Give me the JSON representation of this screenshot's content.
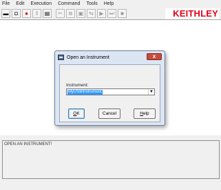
{
  "menu": {
    "items": [
      {
        "label": "File"
      },
      {
        "label": "Edit"
      },
      {
        "label": "Execution"
      },
      {
        "label": "Command"
      },
      {
        "label": "Tools"
      },
      {
        "label": "Help"
      }
    ]
  },
  "toolbar": {
    "buttons": [
      {
        "icon": "new-icon",
        "glyph": "▬",
        "enabled": true
      },
      {
        "icon": "instrument-icon",
        "glyph": "◘",
        "enabled": true
      },
      {
        "icon": "record-icon",
        "glyph": "●",
        "enabled": true
      },
      {
        "icon": "pause-icon",
        "glyph": "‖",
        "enabled": false
      },
      {
        "icon": "print-icon",
        "glyph": "▤",
        "enabled": true
      },
      {
        "icon": "cut-icon",
        "glyph": "✂",
        "enabled": false
      },
      {
        "icon": "copy-icon",
        "glyph": "⧉",
        "enabled": false
      },
      {
        "icon": "paste-icon",
        "glyph": "▣",
        "enabled": false
      },
      {
        "icon": "run-icon",
        "glyph": "⇆",
        "enabled": false
      },
      {
        "icon": "play-icon",
        "glyph": "▶",
        "enabled": false
      },
      {
        "icon": "step-icon",
        "glyph": "⏭",
        "enabled": false
      },
      {
        "icon": "stop-icon",
        "glyph": "■",
        "enabled": false
      }
    ],
    "brand": "KEITHLEY",
    "brand_color": "#e0001a"
  },
  "dialog": {
    "title": "Open an Instrument",
    "close_glyph": "x",
    "field_label": "Instrument:",
    "selected_instrument": "MyUSBInstrument",
    "buttons": {
      "ok": {
        "label_underlined": "O",
        "label_rest": "K"
      },
      "cancel": {
        "label": "Cancel"
      },
      "help": {
        "label_underlined": "H",
        "label_rest": "elp"
      }
    }
  },
  "output": {
    "text": "OPEN AN INSTRUMENT!"
  }
}
